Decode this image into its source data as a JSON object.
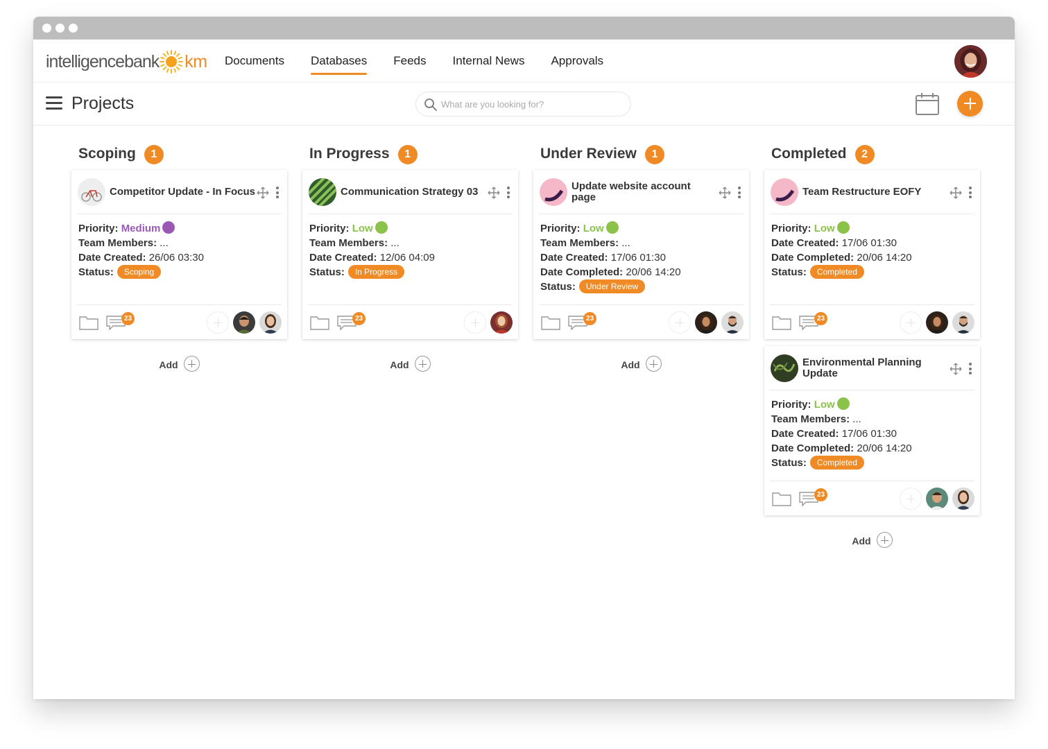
{
  "app": {
    "logo_text": "intelligencebank",
    "logo_suffix": "km",
    "nav": [
      "Documents",
      "Databases",
      "Feeds",
      "Internal News",
      "Approvals"
    ],
    "active_nav": "Databases"
  },
  "page": {
    "title": "Projects",
    "search_placeholder": "What are you looking for?"
  },
  "labels": {
    "priority": "Priority:",
    "team": "Team Members:",
    "created": "Date Created:",
    "completed": "Date Completed:",
    "status": "Status:",
    "add": "Add",
    "team_value": "..."
  },
  "colors": {
    "accent": "#f08a24",
    "priority_medium": "#9b59b6",
    "priority_low": "#8bc34a"
  },
  "columns": [
    {
      "title": "Scoping",
      "count": "1",
      "cards": [
        {
          "title": "Competitor Update - In Focus",
          "priority": "Medium",
          "has_team": true,
          "created": "26/06 03:30",
          "completed": null,
          "status": "Scoping",
          "comments": "23",
          "members": 2
        }
      ]
    },
    {
      "title": "In Progress",
      "count": "1",
      "cards": [
        {
          "title": "Communication Strategy 03",
          "priority": "Low",
          "has_team": true,
          "created": "12/06 04:09",
          "completed": null,
          "status": "In Progress",
          "comments": "23",
          "members": 1
        }
      ]
    },
    {
      "title": "Under Review",
      "count": "1",
      "cards": [
        {
          "title": "Update website account page",
          "priority": "Low",
          "has_team": true,
          "created": "17/06 01:30",
          "completed": "20/06 14:20",
          "status": "Under Review",
          "comments": "23",
          "members": 2
        }
      ]
    },
    {
      "title": "Completed",
      "count": "2",
      "cards": [
        {
          "title": "Team Restructure EOFY",
          "priority": "Low",
          "has_team": false,
          "created": "17/06 01:30",
          "completed": "20/06 14:20",
          "status": "Completed",
          "comments": "23",
          "members": 2
        },
        {
          "title": "Environmental Planning Update",
          "priority": "Low",
          "has_team": true,
          "created": "17/06 01:30",
          "completed": "20/06 14:20",
          "status": "Completed",
          "comments": "23",
          "members": 2
        }
      ]
    }
  ]
}
